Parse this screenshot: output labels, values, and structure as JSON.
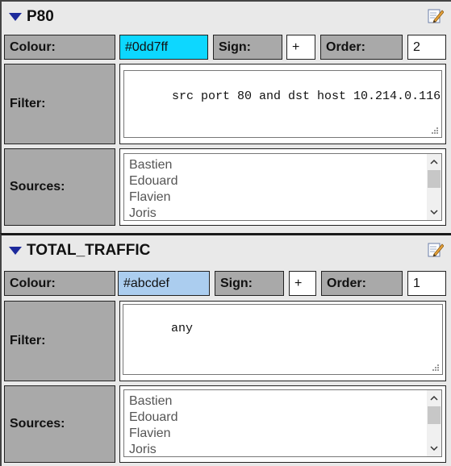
{
  "panels": [
    {
      "title": "P80",
      "colour_label": "Colour:",
      "colour_value": "#0dd7ff",
      "colour_bg": "#0dd7ff",
      "sign_label": "Sign:",
      "sign_value": "+",
      "order_label": "Order:",
      "order_value": "2",
      "filter_label": "Filter:",
      "filter_value": "src port 80 and dst host 10.214.0.116",
      "sources_label": "Sources:",
      "sources": [
        "Bastien",
        "Edouard",
        "Flavien",
        "Joris"
      ]
    },
    {
      "title": "TOTAL_TRAFFIC",
      "colour_label": "Colour:",
      "colour_value": "#abcdef",
      "colour_bg": "#abcdef",
      "sign_label": "Sign:",
      "sign_value": "+",
      "order_label": "Order:",
      "order_value": "1",
      "filter_label": "Filter:",
      "filter_value": "any",
      "sources_label": "Sources:",
      "sources": [
        "Bastien",
        "Edouard",
        "Flavien",
        "Joris"
      ]
    }
  ],
  "icons": {
    "collapse": "triangle-down-icon",
    "edit": "edit-icon",
    "resize": "resize-grip-icon",
    "scroll_up": "chevron-up-icon",
    "scroll_down": "chevron-down-icon"
  }
}
